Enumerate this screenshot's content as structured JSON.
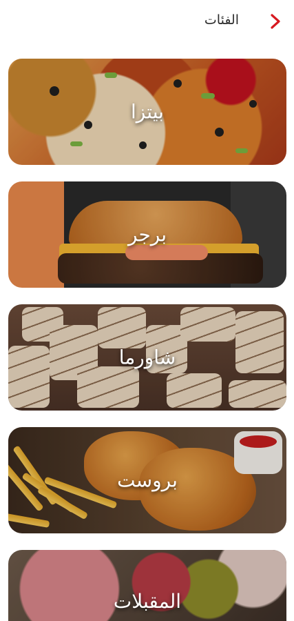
{
  "header": {
    "title": "الفئات",
    "back_icon": "chevron-right-icon",
    "accent_color": "#d71920"
  },
  "categories": [
    {
      "label": "بيتزا"
    },
    {
      "label": "برجر"
    },
    {
      "label": "شاورما"
    },
    {
      "label": "بروست"
    },
    {
      "label": "المقبلات"
    }
  ]
}
